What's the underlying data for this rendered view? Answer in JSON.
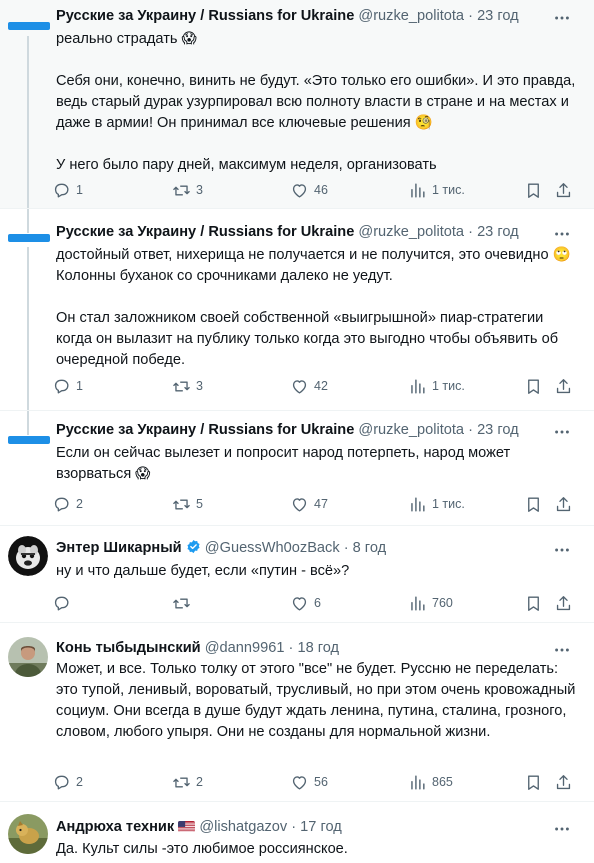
{
  "tweets": [
    {
      "name": "Русские за Украину / Russians for Ukraine",
      "handle": "@ruzke_politota",
      "dot": "·",
      "time": "23 год",
      "body": "реально страдать 😱\n\nСебя они, конечно, винить не будут. «Это только его ошибки». И это правда, ведь старый дурак узурпировал всю полноту власти в стране и на местах и даже в армии! Он принимал все ключевые решения 🧐\n\nУ него было пару дней, максимум неделя, организовать",
      "replies": "1",
      "retweets": "3",
      "likes": "46",
      "views": "1 тис."
    },
    {
      "name": "Русские за Украину / Russians for Ukraine",
      "handle": "@ruzke_politota",
      "dot": "·",
      "time": "23 год",
      "body": "достойный ответ, нихерища не получается и не получится, это очевидно 🙄 Колонны буханок со срочниками далеко не уедут.\n\nОн стал заложником своей собственной «выигрышной» пиар-стратегии когда он вылазит на публику только когда это выгодно чтобы объявить об очередной победе.",
      "replies": "1",
      "retweets": "3",
      "likes": "42",
      "views": "1 тис."
    },
    {
      "name": "Русские за Украину / Russians for Ukraine",
      "handle": "@ruzke_politota",
      "dot": "·",
      "time": "23 год",
      "body": "Если он сейчас вылезет и попросит народ потерпеть, народ может взорваться 😱",
      "replies": "2",
      "retweets": "5",
      "likes": "47",
      "views": "1 тис."
    },
    {
      "name": "Энтер Шикарный",
      "handle": "@GuessWh0ozBack",
      "dot": "·",
      "time": "8 год",
      "body": "ну и что дальше будет, если «путин - всё»?",
      "replies": "",
      "retweets": "",
      "likes": "6",
      "views": "760"
    },
    {
      "name": "Конь тыбыдынский",
      "handle": "@dann9961",
      "dot": "·",
      "time": "18 год",
      "body": "Может, и все. Только толку от этого \"все\" не будет. Руссню не переделать: это тупой, ленивый, вороватый, трусливый, но при этом очень кровожадный социум. Они всегда в душе будут ждать ленина, путина, сталина, грозного, словом, любого упыря. Они не созданы для нормальной жизни.",
      "replies": "2",
      "retweets": "2",
      "likes": "56",
      "views": "865"
    },
    {
      "name": "Андрюха техник",
      "handle": "@lishatgazov",
      "dot": "·",
      "time": "17 год",
      "body": "Да. Культ силы -это любимое россиянское."
    }
  ],
  "icons": {
    "reply": "reply-icon",
    "retweet": "retweet-icon",
    "like": "heart-icon",
    "views": "views-icon",
    "bookmark": "bookmark-icon",
    "share": "share-icon",
    "more": "more-icon",
    "verified": "verified-badge-icon"
  },
  "colors": {
    "text": "#0f1419",
    "secondary": "#536471",
    "flag_blue": "#1d8fe6",
    "verified": "#1d9bf0",
    "highlight_bg": "#f7f9f9"
  }
}
